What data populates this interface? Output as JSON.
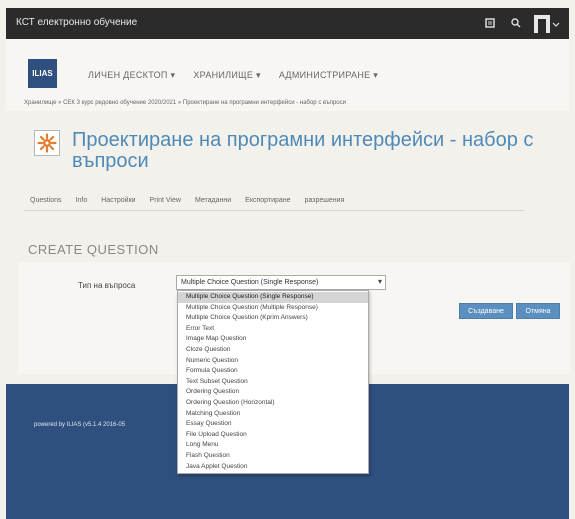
{
  "topbar": {
    "title": "КСТ електронно обучение",
    "icons": [
      "menu-icon",
      "search-icon",
      "user-avatar-icon"
    ]
  },
  "mainnav": [
    {
      "label": "ЛИЧЕН ДЕСКТОП ▾"
    },
    {
      "label": "ХРАНИЛИЩЕ ▾"
    },
    {
      "label": "АДМИНИСТРИРАНЕ ▾"
    }
  ],
  "breadcrumb": "Хранилище » СЕК 3 курс редовно обучение 2020/2021 » Проектиране на програмни интерфейси - набор с въпроси",
  "page": {
    "title": "Проектиране на програмни интерфейси - набор с въпроси",
    "logo": "ILIAS"
  },
  "tabs": [
    {
      "label": "Questions"
    },
    {
      "label": "Info"
    },
    {
      "label": "Настройки"
    },
    {
      "label": "Print View"
    },
    {
      "label": "Метаданни"
    },
    {
      "label": "Експортиране"
    },
    {
      "label": "разрешения"
    }
  ],
  "form": {
    "section_title": "CREATE QUESTION",
    "type_label": "Тип на въпроса",
    "selected_type": "Multiple Choice Question (Single Response)",
    "create_button": "Създаване",
    "cancel_button": "Отмяна"
  },
  "question_types": [
    "Multiple Choice Question (Single Response)",
    "Multiple Choice Question (Multiple Response)",
    "Multiple Choice Question (Kprim Answers)",
    "Error Text",
    "Image Map Question",
    "Cloze Question",
    "Numeric Question",
    "Formula Question",
    "Text Subset Question",
    "Ordering Question",
    "Ordering Question (Horizontal)",
    "Matching Question",
    "Essay Question",
    "File Upload Question",
    "Long Menu",
    "Flash Question",
    "Java Applet Question"
  ],
  "footer": {
    "text": "powered by ILIAS (v5.1.4 2016-05"
  }
}
